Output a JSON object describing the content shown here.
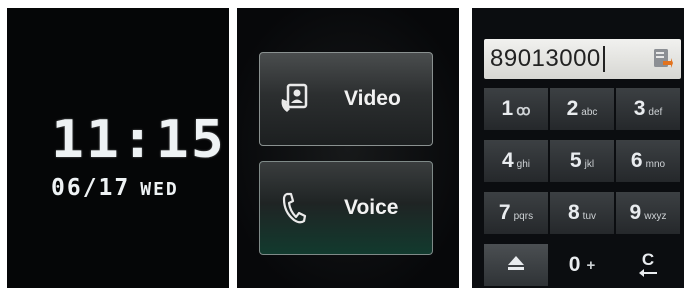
{
  "clock_screen": {
    "time": "11:15",
    "date": "06/17",
    "weekday": "WED"
  },
  "call_type_screen": {
    "video_label": "Video",
    "voice_label": "Voice",
    "video_icon": "video-contact-icon",
    "voice_icon": "phone-handset-icon"
  },
  "dialer_screen": {
    "dialed_number": "89013000",
    "contact_icon": "contacts-icon",
    "keys": [
      {
        "num": "1",
        "sub": "ꝏ",
        "icon": "voicemail-icon"
      },
      {
        "num": "2",
        "sub": "abc"
      },
      {
        "num": "3",
        "sub": "def"
      },
      {
        "num": "4",
        "sub": "ghi"
      },
      {
        "num": "5",
        "sub": "jkl"
      },
      {
        "num": "6",
        "sub": "mno"
      },
      {
        "num": "7",
        "sub": "pqrs"
      },
      {
        "num": "8",
        "sub": "tuv"
      },
      {
        "num": "9",
        "sub": "wxyz"
      },
      {
        "num": "",
        "sub": "",
        "icon": "eject-icon"
      },
      {
        "num": "0",
        "sub": "+"
      },
      {
        "num": "C",
        "sub": "",
        "icon": "clear-icon"
      }
    ]
  },
  "colors": {
    "screen_bg": "#050607",
    "clock_text": "#eef2f4",
    "button_border": "#8a9190",
    "voice_glow": "#123a2e",
    "number_bar_bg": "#e6e6e3",
    "key_bg": "#303437"
  }
}
